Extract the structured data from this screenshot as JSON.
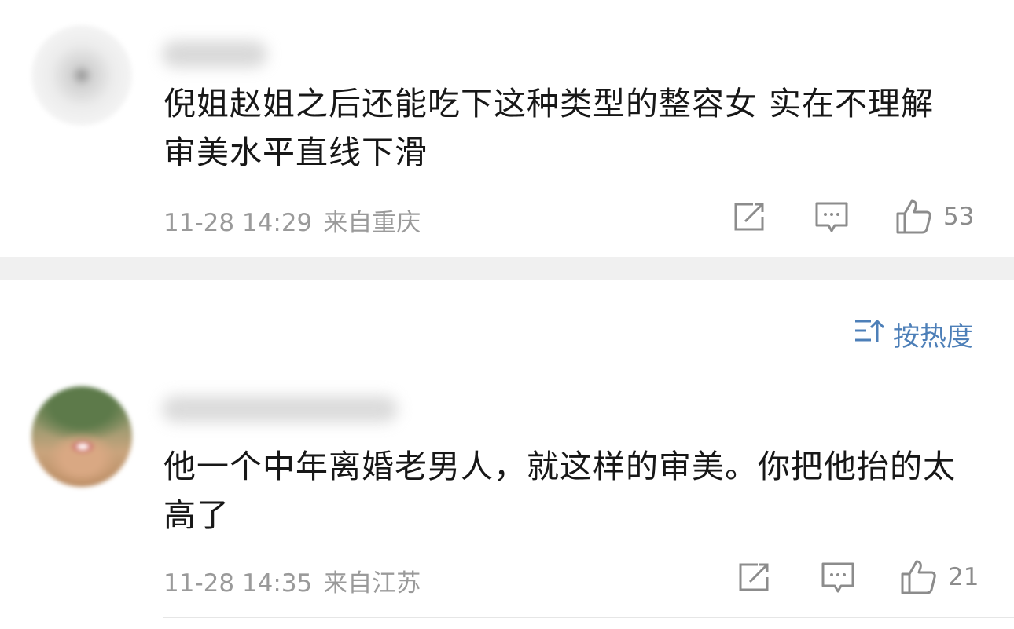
{
  "comments": [
    {
      "text": "倪姐赵姐之后还能吃下这种类型的整容女  实在不理解  审美水平直线下滑",
      "time": "11-28 14:29",
      "location": "来自重庆",
      "likes": "53"
    },
    {
      "text": "他一个中年离婚老男人，就这样的审美。你把他抬的太高了",
      "time": "11-28 14:35",
      "location": "来自江苏",
      "likes": "21"
    }
  ],
  "sort": {
    "label": "按热度",
    "icon": "sort-icon",
    "color": "#4d7fb8"
  },
  "icons": {
    "share": "share-icon",
    "reply": "comment-icon",
    "like": "thumbs-up-icon"
  }
}
